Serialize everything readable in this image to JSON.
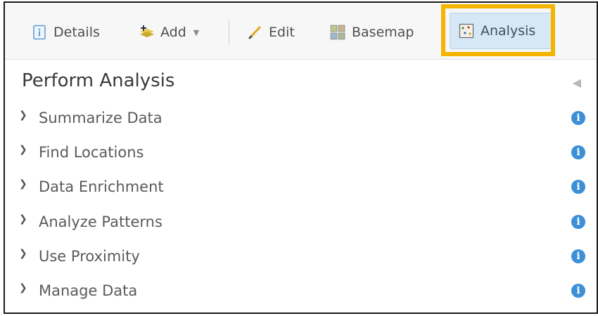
{
  "toolbar": {
    "details_label": "Details",
    "add_label": "Add",
    "edit_label": "Edit",
    "basemap_label": "Basemap",
    "analysis_label": "Analysis",
    "highlight_color": "#f5b400",
    "active_button_color": "#d6e8f6"
  },
  "panel": {
    "title": "Perform Analysis",
    "collapse_glyph": "◀",
    "items": [
      {
        "label": "Summarize Data"
      },
      {
        "label": "Find Locations"
      },
      {
        "label": "Data Enrichment"
      },
      {
        "label": "Analyze Patterns"
      },
      {
        "label": "Use Proximity"
      },
      {
        "label": "Manage Data"
      }
    ],
    "info_glyph": "i",
    "info_color": "#3d8fd6"
  }
}
